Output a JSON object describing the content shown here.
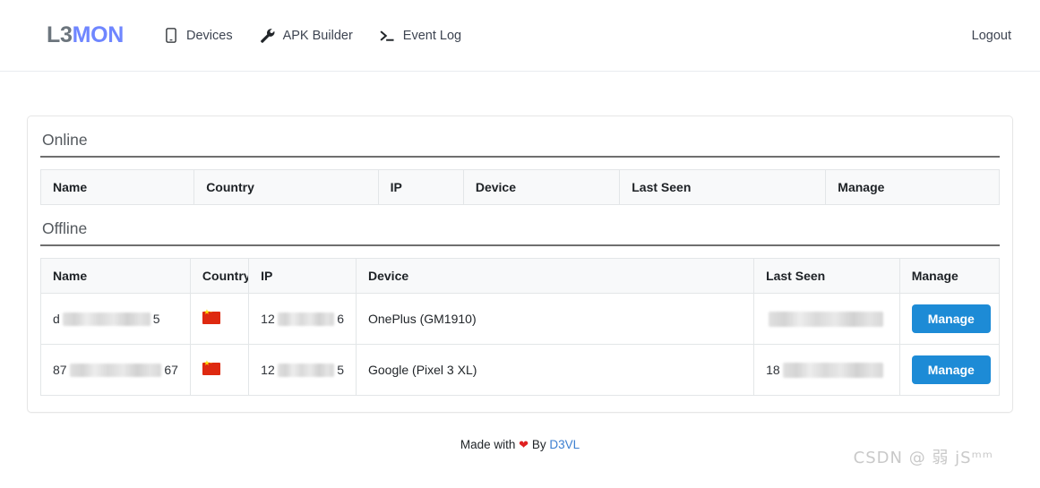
{
  "navbar": {
    "brand_part1": "L3",
    "brand_part2": "MON",
    "links": [
      {
        "label": "Devices",
        "icon": "mobile-phone-icon"
      },
      {
        "label": "APK Builder",
        "icon": "wrench-icon"
      },
      {
        "label": "Event Log",
        "icon": "terminal-prompt-icon"
      }
    ],
    "logout_label": "Logout"
  },
  "sections": {
    "online": {
      "title": "Online",
      "columns": [
        "Name",
        "Country",
        "IP",
        "Device",
        "Last Seen",
        "Manage"
      ],
      "rows": []
    },
    "offline": {
      "title": "Offline",
      "columns": [
        "Name",
        "Country",
        "IP",
        "Device",
        "Last Seen",
        "Manage"
      ],
      "rows": [
        {
          "name_prefix": "d",
          "name_suffix": "5",
          "country": "China",
          "country_flag": "cn-flag-icon",
          "ip_prefix": "12",
          "ip_suffix": "6",
          "device": "OnePlus (GM1910)",
          "last_seen_prefix": "",
          "manage_label": "Manage"
        },
        {
          "name_prefix": "87",
          "name_suffix": "67",
          "country": "China",
          "country_flag": "cn-flag-icon",
          "ip_prefix": "12",
          "ip_suffix": "5",
          "device": "Google (Pixel 3 XL)",
          "last_seen_prefix": "18",
          "manage_label": "Manage"
        }
      ]
    }
  },
  "footer": {
    "made_with": "Made with",
    "heart": "❤",
    "by": "By",
    "author": "D3VL",
    "watermark": "CSDN @ 弱 jSᵐᵐ"
  },
  "colors": {
    "brand_accent": "#6f86ff",
    "brand_muted": "#6c757d",
    "button_primary": "#1d8bd6",
    "link": "#3c7fd0",
    "heart": "#e02020"
  }
}
